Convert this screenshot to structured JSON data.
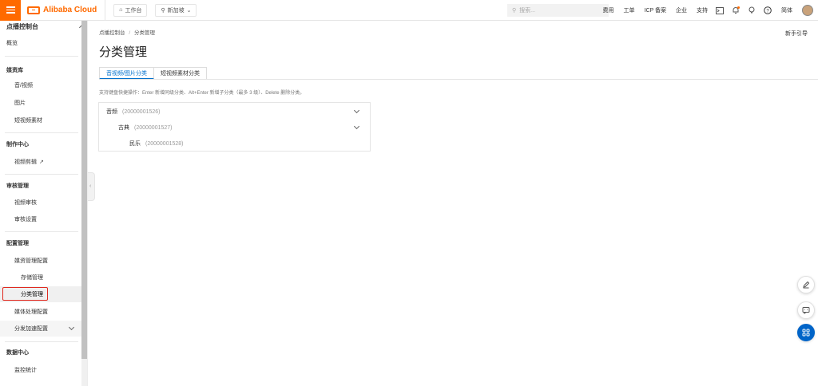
{
  "topbar": {
    "logo": "Alibaba Cloud",
    "workbench": "工作台",
    "region": "新加坡",
    "search_placeholder": "搜索...",
    "links": [
      "费用",
      "工单",
      "ICP 备案",
      "企业",
      "支持"
    ],
    "lang": "简体"
  },
  "sidebar": {
    "header": "点播控制台",
    "overview": "概览",
    "media_title": "媒资库",
    "audio_video": "音/视频",
    "images": "图片",
    "short_video": "短视频素材",
    "production_title": "制作中心",
    "video_editing": "视频剪辑",
    "review_title": "审核管理",
    "video_review": "视频审核",
    "review_settings": "审核设置",
    "config_title": "配置管理",
    "media_config": "媒资管理配置",
    "storage": "存储管理",
    "category": "分类管理",
    "processing": "媒体处理配置",
    "cdn": "分发加速配置",
    "data_title": "数据中心",
    "monitoring": "监控统计"
  },
  "breadcrumb": {
    "root": "点播控制台",
    "sep": "/",
    "current": "分类管理"
  },
  "guide": "新手引导",
  "page_title": "分类管理",
  "tabs": [
    "音视频/图片分类",
    "短视频素材分类"
  ],
  "hint": "支持键盘快捷操作：Enter 新增同级分类、Alt+Enter 新增子分类（最多 3 级）、Delete 删除分类。",
  "tree": [
    {
      "name": "音频",
      "id": "(20000001526)"
    },
    {
      "name": "古典",
      "id": "(20000001527)"
    },
    {
      "name": "民乐",
      "id": "(20000001528)"
    }
  ],
  "colors": {
    "brand": "#ff6a00",
    "accent": "#0070cc",
    "highlight_border": "#e0291f"
  }
}
